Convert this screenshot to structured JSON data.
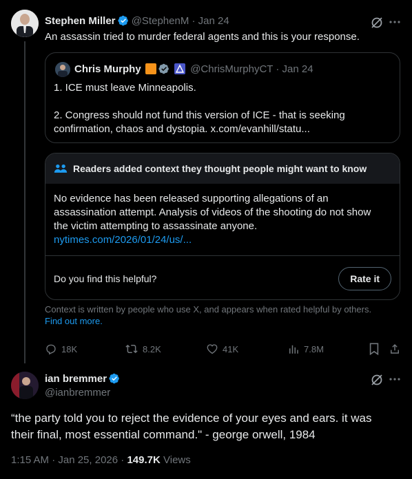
{
  "post1": {
    "author_name": "Stephen Miller",
    "author_handle": "@StephenM",
    "date": "· Jan 24",
    "text": "An assassin tried to murder federal agents and this is your response."
  },
  "quote": {
    "author_name": "Chris Murphy",
    "author_handle": "@ChrisMurphyCT",
    "date": "· Jan 24",
    "line1": "1. ICE must leave Minneapolis.",
    "line2": "2. Congress should not fund this version of ICE - that is seeking",
    "line3": "confirmation, chaos and dystopia. x.com/evanhill/statu..."
  },
  "note": {
    "header": "Readers added context they thought people might want to know",
    "body_line1": "No evidence has been released supporting allegations of an",
    "body_line2": "assassination attempt.  Analysis of videos of the shooting do not show",
    "body_line3": "the victim attempting to assassinate anyone.",
    "link": "nytimes.com/2026/01/24/us/...",
    "question": "Do you find this helpful?",
    "rate_label": "Rate it"
  },
  "context_footer": {
    "text": "Context is written by people who use X, and appears when rated helpful by others.",
    "link": "Find out more."
  },
  "actions": {
    "replies": "18K",
    "reposts": "8.2K",
    "likes": "41K",
    "views": "7.8M"
  },
  "post2": {
    "author_name": "ian bremmer",
    "author_handle": "@ianbremmer",
    "text_line1": "“the party told you to reject the evidence of your eyes and ears. it was",
    "text_line2": "their final, most essential command.\" - george orwell, 1984",
    "time": "1:15 AM · Jan 25, 2026 ·",
    "views_count": "149.7K",
    "views_label": "Views"
  },
  "colors": {
    "background": "#000000",
    "text": "#e7e9ea",
    "muted": "#71767b",
    "link": "#1d9bf0",
    "border": "#2f3336",
    "verified_blue": "#1d9bf0"
  }
}
